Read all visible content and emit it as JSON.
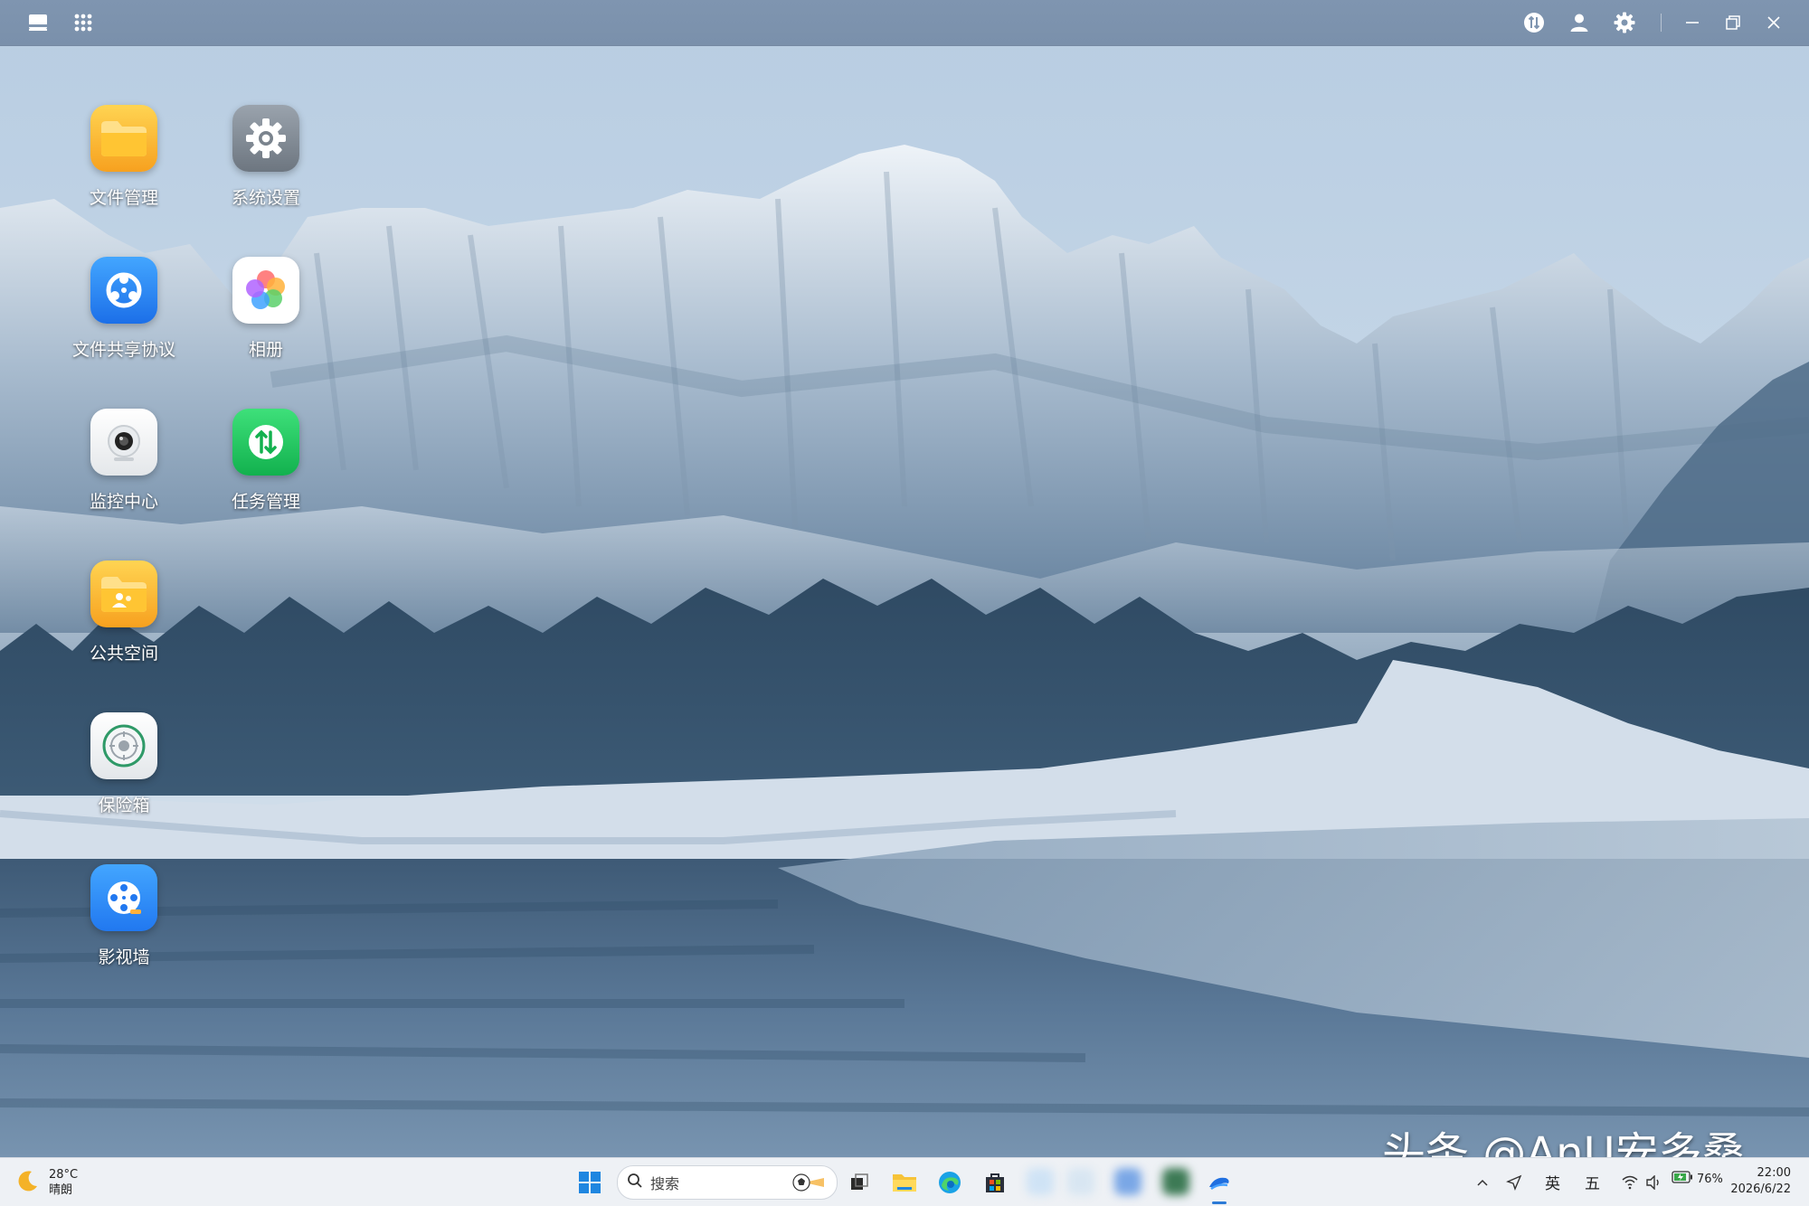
{
  "desktop_icons": [
    {
      "id": "file-manager",
      "label": "文件管理",
      "icon": "folder-icon"
    },
    {
      "id": "system-settings",
      "label": "系统设置",
      "icon": "gear-icon"
    },
    {
      "id": "file-sharing",
      "label": "文件共享协议",
      "icon": "share-protocol-icon"
    },
    {
      "id": "photos",
      "label": "相册",
      "icon": "photos-flower-icon"
    },
    {
      "id": "monitor-center",
      "label": "监控中心",
      "icon": "camera-icon"
    },
    {
      "id": "task-manager",
      "label": "任务管理",
      "icon": "transfer-arrows-icon"
    },
    {
      "id": "public-space",
      "label": "公共空间",
      "icon": "shared-folder-icon"
    },
    {
      "id": "safe-box",
      "label": "保险箱",
      "icon": "safe-icon"
    },
    {
      "id": "video-wall",
      "label": "影视墙",
      "icon": "film-reel-icon"
    }
  ],
  "topbar": {
    "left_icons": [
      "desktop-icon",
      "app-grid-icon"
    ],
    "right_icons": [
      "task-transfer-icon",
      "user-icon",
      "gear-icon",
      "minimize-icon",
      "restore-icon",
      "close-icon"
    ]
  },
  "watermark": "头条 @AnU安多桑",
  "taskbar": {
    "weather": {
      "temp": "28°C",
      "desc": "晴朗",
      "icon": "moon-icon"
    },
    "search_placeholder": "搜索",
    "pinned_icons": [
      "windows-start-icon",
      "search-icon",
      "file-explorer-icon",
      "edge-icon",
      "store-icon"
    ],
    "tray": {
      "ime_lang": "英",
      "ime_mode": "五",
      "battery": "76%"
    },
    "clock": {
      "time": "22:00",
      "date": "2026/6/22"
    }
  },
  "colors": {
    "topbar": "#7f95b0",
    "taskbar": "#eef1f5",
    "accent": "#2c7ad6"
  }
}
